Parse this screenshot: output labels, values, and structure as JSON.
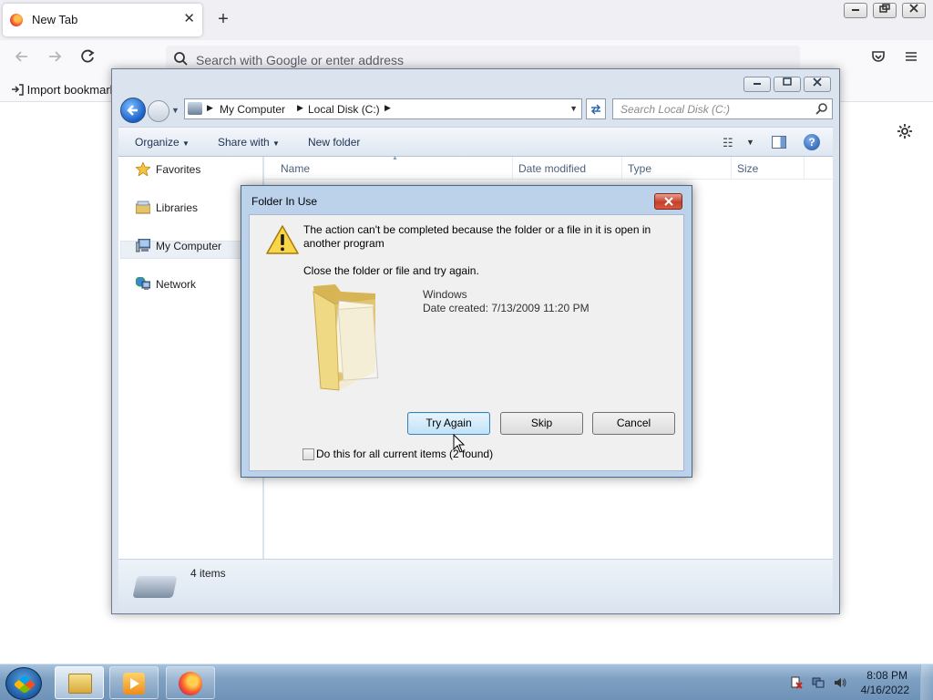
{
  "firefox": {
    "tab_title": "New Tab",
    "tab_close": "✕",
    "new_tab": "+",
    "urlbar_placeholder": "Search with Google or enter address",
    "import_bookmarks": "Import bookmark",
    "window_minimize": "▭",
    "window_maximize": "❐",
    "window_close": "✕"
  },
  "explorer": {
    "breadcrumb": [
      "My Computer",
      "Local Disk (C:)"
    ],
    "search_placeholder": "Search Local Disk (C:)",
    "commands": {
      "organize": "Organize",
      "share_with": "Share with",
      "new_folder": "New folder"
    },
    "nav_items": [
      "Favorites",
      "Libraries",
      "My Computer",
      "Network"
    ],
    "selected_nav": "My Computer",
    "columns": [
      "Name",
      "Date modified",
      "Type",
      "Size"
    ],
    "status_count": "4 items"
  },
  "dialog": {
    "title": "Folder In Use",
    "message": "The action can't be completed because the folder or a file in it is open in another program",
    "instruction": "Close the folder or file and try again.",
    "item_name": "Windows",
    "item_date": "Date created: 7/13/2009 11:20 PM",
    "buttons": {
      "try_again": "Try Again",
      "skip": "Skip",
      "cancel": "Cancel"
    },
    "checkbox_label": "Do this for all current items (2 found)",
    "checkbox_checked": false
  },
  "taskbar": {
    "time": "8:08 PM",
    "date": "4/16/2022"
  }
}
